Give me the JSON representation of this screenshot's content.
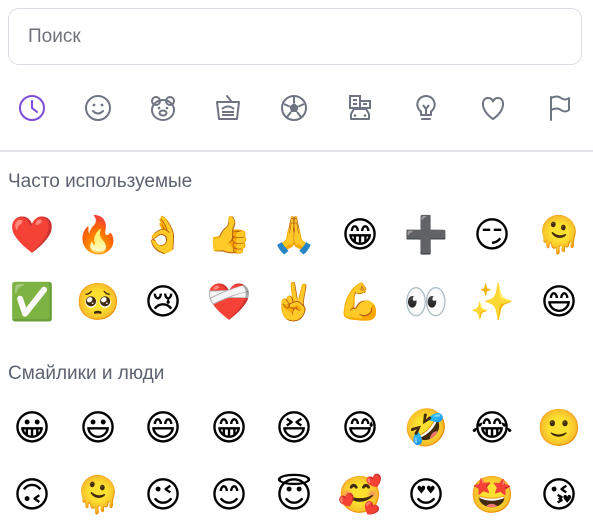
{
  "search": {
    "placeholder": "Поиск",
    "value": ""
  },
  "categories": [
    {
      "name": "recent",
      "icon": "clock-icon",
      "active": true
    },
    {
      "name": "smileys",
      "icon": "smiley-icon",
      "active": false
    },
    {
      "name": "animals",
      "icon": "hamster-icon",
      "active": false
    },
    {
      "name": "food",
      "icon": "food-icon",
      "active": false
    },
    {
      "name": "activity",
      "icon": "soccer-ball-icon",
      "active": false
    },
    {
      "name": "travel",
      "icon": "buildings-car-icon",
      "active": false
    },
    {
      "name": "objects",
      "icon": "lightbulb-icon",
      "active": false
    },
    {
      "name": "symbols",
      "icon": "heart-icon",
      "active": false
    },
    {
      "name": "flags",
      "icon": "flag-icon",
      "active": false
    }
  ],
  "colors": {
    "active": "#7c4dd8",
    "icon": "#6e7481",
    "divider": "#e2e4e9",
    "section_title": "#5c6270"
  },
  "sections": [
    {
      "title": "Часто используемые",
      "emojis": [
        "❤️",
        "🔥",
        "👌",
        "👍",
        "🙏",
        "😁",
        "➕",
        "😏",
        "🫠",
        "✅",
        "🥺",
        "😢",
        "❤️‍🩹",
        "✌️",
        "💪",
        "👀",
        "✨",
        "😄"
      ]
    },
    {
      "title": "Смайлики и люди",
      "emojis": [
        "😀",
        "😃",
        "😄",
        "😁",
        "😆",
        "😅",
        "🤣",
        "😂",
        "🙂",
        "🙃",
        "🫠",
        "😉",
        "😊",
        "😇",
        "🥰",
        "😍",
        "🤩",
        "😘"
      ]
    }
  ]
}
